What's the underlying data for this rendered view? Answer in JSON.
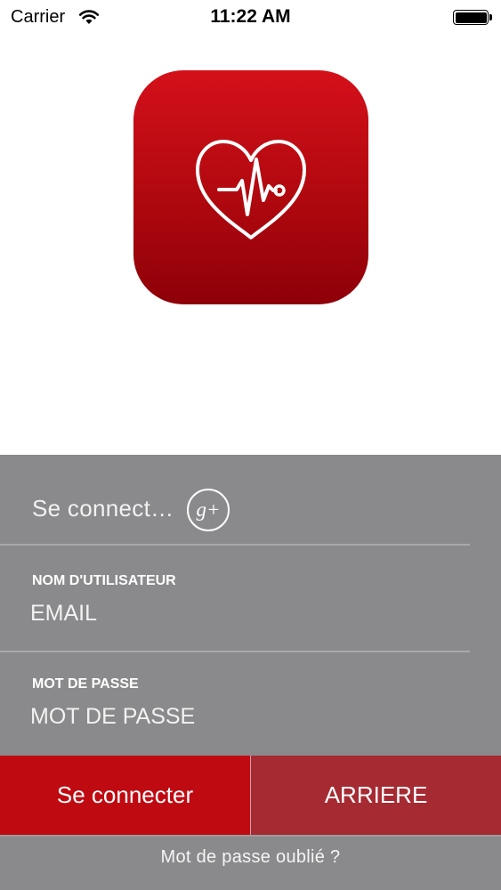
{
  "status_bar": {
    "carrier": "Carrier",
    "time": "11:22 AM",
    "battery_level": 1.0
  },
  "app_icon": {
    "icon": "heart-pulse-icon",
    "gradient_top": "#d4101a",
    "gradient_bottom": "#8e0008"
  },
  "login": {
    "google_label": "Se connect…",
    "google_icon_text": "g+",
    "username_label": "NOM D'UTILISATEUR",
    "username_placeholder": "EMAIL",
    "password_label": "MOT DE PASSE",
    "password_placeholder": "MOT DE PASSE"
  },
  "buttons": {
    "connect_label": "Se connecter",
    "back_label": "ARRIERE"
  },
  "footer": {
    "forgot_label": "Mot de passe oublié ?"
  },
  "colors": {
    "panel_gray": "#8a898b",
    "connect_red": "#c00a12",
    "back_red": "#a62a32"
  }
}
